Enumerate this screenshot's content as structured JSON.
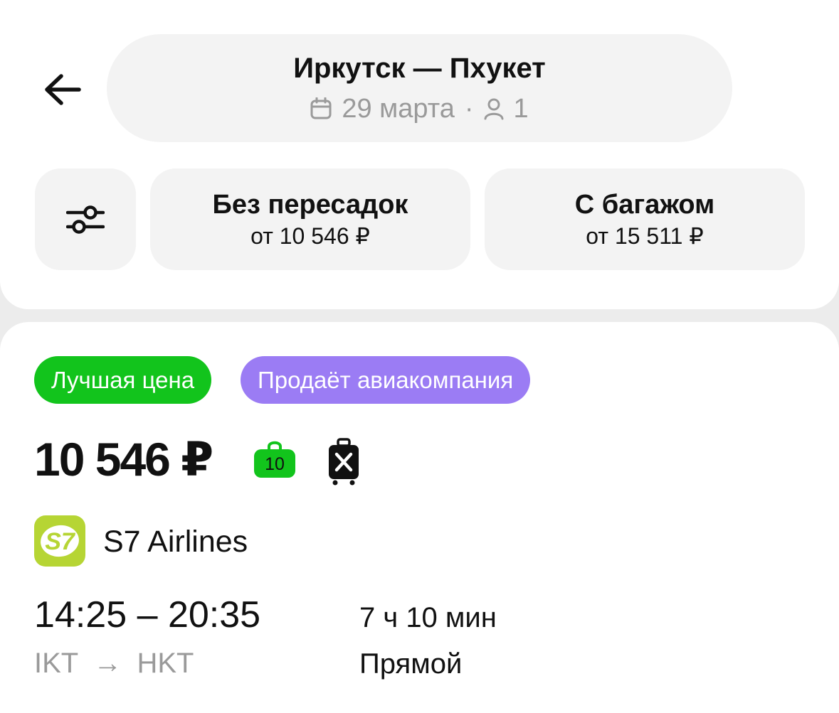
{
  "header": {
    "route_title": "Иркутск — Пхукет",
    "date": "29 марта",
    "separator": "·",
    "passengers": "1",
    "back_icon": "arrow-left-icon",
    "calendar_icon": "calendar-icon",
    "passenger_icon": "person-icon"
  },
  "filters": {
    "settings_icon": "sliders-icon",
    "direct": {
      "title": "Без пересадок",
      "price": "от 10 546 ₽"
    },
    "baggage": {
      "title": "С багажом",
      "price": "от 15 511 ₽"
    }
  },
  "offer": {
    "badges": [
      {
        "label": "Лучшая цена",
        "color": "#12c41c"
      },
      {
        "label": "Продаёт авиакомпания",
        "color": "#9b7cf4"
      }
    ],
    "price": "10 546 ₽",
    "hand_luggage": "10",
    "hand_luggage_icon": "bag-icon",
    "no_baggage_icon": "suitcase-crossed-icon",
    "airline": {
      "name": "S7 Airlines",
      "logo_text": "S7",
      "logo_color": "#b6d534"
    },
    "times": "14:25 – 20:35",
    "from": "IKT",
    "arrow": "→",
    "to": "HKT",
    "duration": "7 ч 10 мин",
    "stops": "Прямой"
  }
}
